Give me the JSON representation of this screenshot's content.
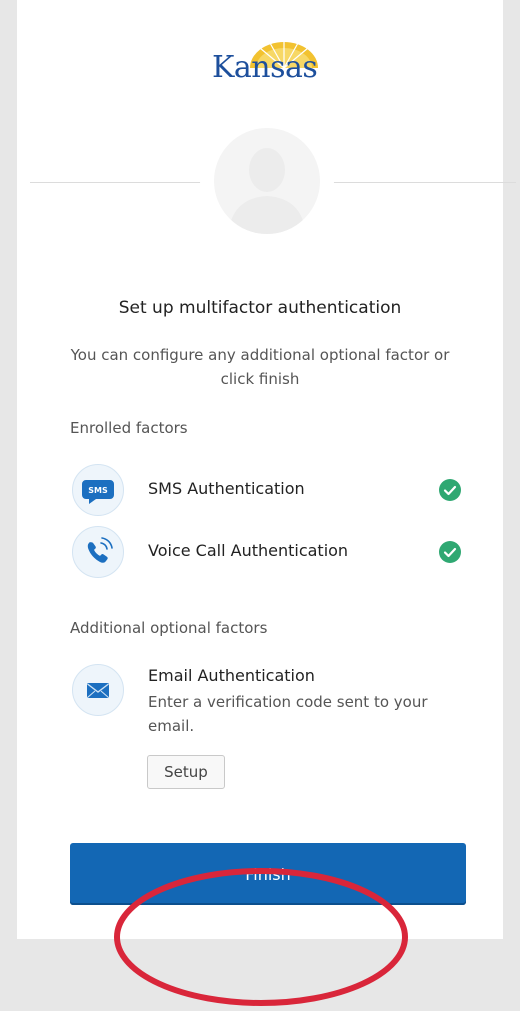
{
  "header": {
    "logo_text": "Kansas"
  },
  "page": {
    "title": "Set up multifactor authentication",
    "subtitle": "You can configure any additional optional factor or click finish"
  },
  "enrolled": {
    "label": "Enrolled factors",
    "factors": [
      {
        "name": "SMS Authentication",
        "icon": "sms-icon",
        "icon_text": "SMS",
        "status": "enrolled"
      },
      {
        "name": "Voice Call Authentication",
        "icon": "phone-icon",
        "status": "enrolled"
      }
    ]
  },
  "optional": {
    "label": "Additional optional factors",
    "factors": [
      {
        "name": "Email Authentication",
        "icon": "email-icon",
        "description": "Enter a verification code sent to your email.",
        "action_label": "Setup"
      }
    ]
  },
  "finish": {
    "label": "Finish"
  },
  "colors": {
    "primary": "#1367b4",
    "success": "#2fa872",
    "annotation": "#d9263a"
  }
}
